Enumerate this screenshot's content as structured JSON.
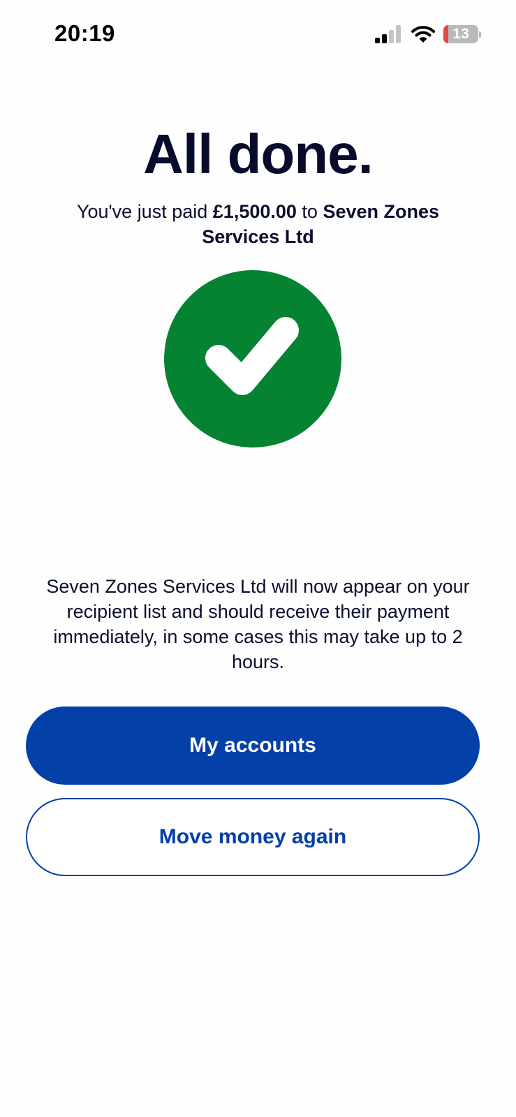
{
  "status_bar": {
    "time": "20:19",
    "battery_level": "13",
    "battery_fraction": 0.13,
    "icons": [
      "cellular-signal-icon",
      "wifi-icon",
      "battery-icon"
    ]
  },
  "confirmation": {
    "headline": "All done.",
    "paid_prefix": "You've just paid",
    "amount": "£1,500.00",
    "paid_connector": "to",
    "recipient": "Seven Zones Services Ltd",
    "status_icon": "check-icon",
    "info": "Seven Zones Services Ltd will now appear on your recipient list and should receive their payment immediately, in some cases this may take up to 2 hours."
  },
  "actions": {
    "primary_label": "My accounts",
    "secondary_label": "Move money again"
  },
  "colors": {
    "brand_blue": "#0340a8",
    "success_green": "#058333",
    "text_navy": "#070c2c",
    "battery_low": "#e8463f"
  }
}
